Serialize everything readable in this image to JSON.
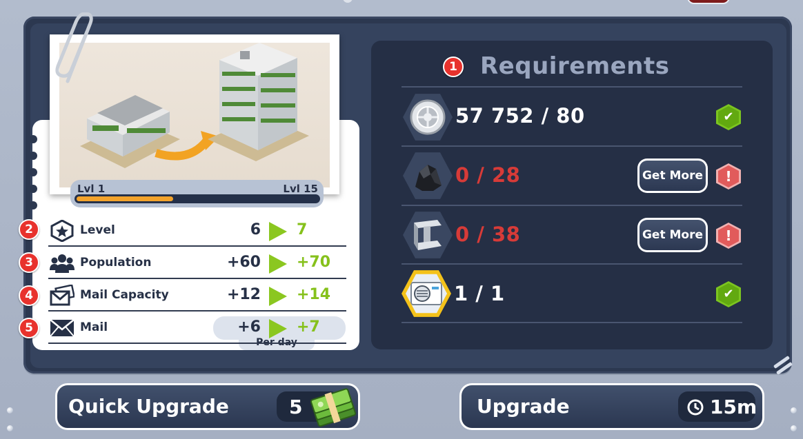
{
  "requirements": {
    "title": "Requirements",
    "badge": "1",
    "items": [
      {
        "icon": "tire-icon",
        "amount": "57 752 / 80",
        "status": "met"
      },
      {
        "icon": "coal-icon",
        "amount": "0 / 28",
        "status": "missing",
        "action": "Get More"
      },
      {
        "icon": "steel-beam-icon",
        "amount": "0 / 38",
        "status": "missing",
        "action": "Get More"
      },
      {
        "icon": "air-conditioner-icon",
        "amount": "1 / 1",
        "status": "met"
      }
    ],
    "met_symbol": "✔",
    "missing_symbol": "!"
  },
  "building": {
    "level_from": "Lvl 1",
    "level_to": "Lvl 15",
    "progress": 0.4
  },
  "stats": [
    {
      "badge": "2",
      "icon": "star-shield-icon",
      "label": "Level",
      "old": "6",
      "new": "7"
    },
    {
      "badge": "3",
      "icon": "population-icon",
      "label": "Population",
      "old": "+60",
      "new": "+70"
    },
    {
      "badge": "4",
      "icon": "mail-stack-icon",
      "label": "Mail Capacity",
      "old": "+12",
      "new": "+14"
    },
    {
      "badge": "5",
      "icon": "envelope-icon",
      "label": "Mail",
      "old": "+6",
      "new": "+7",
      "note": "Per day"
    }
  ],
  "buttons": {
    "quick_upgrade_label": "Quick Upgrade",
    "quick_upgrade_price": "5",
    "upgrade_label": "Upgrade",
    "upgrade_time": "15m"
  },
  "colors": {
    "accent_green": "#86c11c",
    "missing_red": "#d73b38",
    "panel_dark": "#252f45",
    "progress_orange": "#f3a32b"
  }
}
